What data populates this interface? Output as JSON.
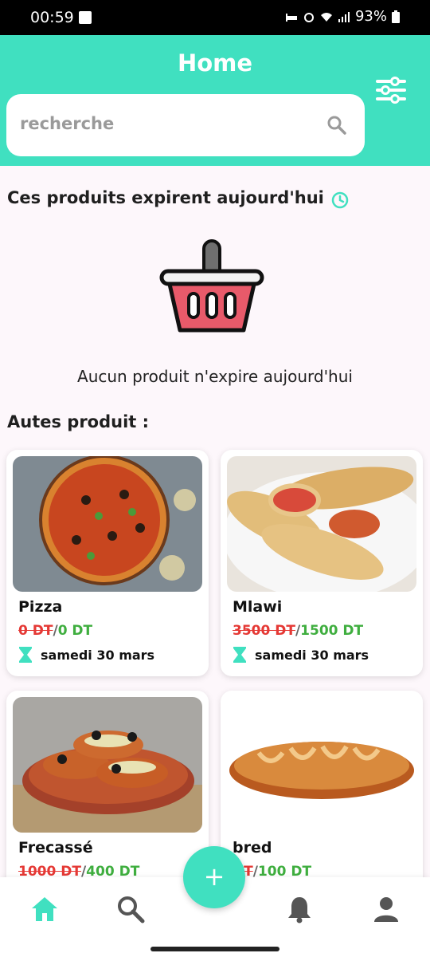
{
  "status_bar": {
    "time": "00:59",
    "battery": "93%"
  },
  "header": {
    "title": "Home"
  },
  "search": {
    "placeholder": "recherche"
  },
  "expiring_section": {
    "title": "Ces produits expirent aujourd'hui",
    "empty_message": "Aucun produit n'expire aujourd'hui"
  },
  "other_section": {
    "title": "Autes produit :"
  },
  "products": [
    {
      "name": "Pizza",
      "old_price": "0 DT",
      "new_price": "0 DT",
      "date": "samedi 30 mars"
    },
    {
      "name": "Mlawi",
      "old_price": "3500 DT",
      "new_price": "1500 DT",
      "date": "samedi 30 mars"
    },
    {
      "name": "Frecassé",
      "old_price": "1000 DT",
      "new_price": "400 DT",
      "date": ""
    },
    {
      "name": "bred",
      "old_price": "DT",
      "new_price": "100 DT",
      "date": ""
    }
  ],
  "fab": {
    "label": "+"
  },
  "colors": {
    "accent": "#40e0c0",
    "old_price": "#e53935",
    "new_price": "#3fae3f"
  },
  "nav_items": [
    "home-icon",
    "search-icon",
    "bell-icon",
    "profile-icon"
  ]
}
